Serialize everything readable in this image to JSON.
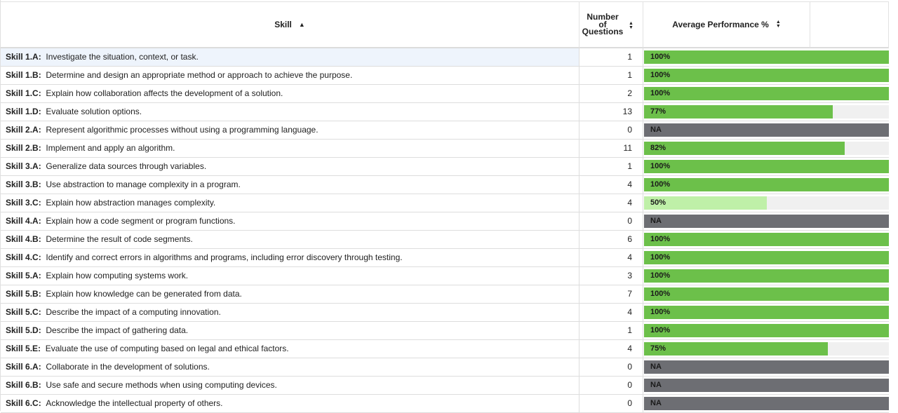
{
  "header": {
    "skill_label": "Skill",
    "skill_sort_icon": "sort-asc-icon",
    "num_label_line1": "Number",
    "num_label_line2": "of",
    "num_label_line3": "Questions",
    "num_sort_icon": "sort-both-icon",
    "perf_label": "Average Performance %",
    "perf_sort_icon": "sort-both-icon"
  },
  "colors": {
    "full": "#6cc04a",
    "partial_light": "#bff0a8",
    "na": "#6d6e73",
    "track": "#f0f0f0"
  },
  "rows": [
    {
      "code": "Skill 1.A:",
      "desc": "Investigate the situation, context, or task.",
      "count": "1",
      "perf_label": "100%",
      "perf": 100,
      "kind": "full"
    },
    {
      "code": "Skill 1.B:",
      "desc": "Determine and design an appropriate method or approach to achieve the purpose.",
      "count": "1",
      "perf_label": "100%",
      "perf": 100,
      "kind": "full"
    },
    {
      "code": "Skill 1.C:",
      "desc": "Explain how collaboration affects the development of a solution.",
      "count": "2",
      "perf_label": "100%",
      "perf": 100,
      "kind": "full"
    },
    {
      "code": "Skill 1.D:",
      "desc": "Evaluate solution options.",
      "count": "13",
      "perf_label": "77%",
      "perf": 77,
      "kind": "full"
    },
    {
      "code": "Skill 2.A:",
      "desc": "Represent algorithmic processes without using a programming language.",
      "count": "0",
      "perf_label": "NA",
      "perf": 100,
      "kind": "na"
    },
    {
      "code": "Skill 2.B:",
      "desc": "Implement and apply an algorithm.",
      "count": "11",
      "perf_label": "82%",
      "perf": 82,
      "kind": "full"
    },
    {
      "code": "Skill 3.A:",
      "desc": "Generalize data sources through variables.",
      "count": "1",
      "perf_label": "100%",
      "perf": 100,
      "kind": "full"
    },
    {
      "code": "Skill 3.B:",
      "desc": "Use abstraction to manage complexity in a program.",
      "count": "4",
      "perf_label": "100%",
      "perf": 100,
      "kind": "full"
    },
    {
      "code": "Skill 3.C:",
      "desc": "Explain how abstraction manages complexity.",
      "count": "4",
      "perf_label": "50%",
      "perf": 50,
      "kind": "light"
    },
    {
      "code": "Skill 4.A:",
      "desc": "Explain how a code segment or program functions.",
      "count": "0",
      "perf_label": "NA",
      "perf": 100,
      "kind": "na"
    },
    {
      "code": "Skill 4.B:",
      "desc": "Determine the result of code segments.",
      "count": "6",
      "perf_label": "100%",
      "perf": 100,
      "kind": "full"
    },
    {
      "code": "Skill 4.C:",
      "desc": "Identify and correct errors in algorithms and programs, including error discovery through testing.",
      "count": "4",
      "perf_label": "100%",
      "perf": 100,
      "kind": "full"
    },
    {
      "code": "Skill 5.A:",
      "desc": "Explain how computing systems work.",
      "count": "3",
      "perf_label": "100%",
      "perf": 100,
      "kind": "full"
    },
    {
      "code": "Skill 5.B:",
      "desc": "Explain how knowledge can be generated from data.",
      "count": "7",
      "perf_label": "100%",
      "perf": 100,
      "kind": "full"
    },
    {
      "code": "Skill 5.C:",
      "desc": "Describe the impact of a computing innovation.",
      "count": "4",
      "perf_label": "100%",
      "perf": 100,
      "kind": "full"
    },
    {
      "code": "Skill 5.D:",
      "desc": "Describe the impact of gathering data.",
      "count": "1",
      "perf_label": "100%",
      "perf": 100,
      "kind": "full"
    },
    {
      "code": "Skill 5.E:",
      "desc": "Evaluate the use of computing based on legal and ethical factors.",
      "count": "4",
      "perf_label": "75%",
      "perf": 75,
      "kind": "full"
    },
    {
      "code": "Skill 6.A:",
      "desc": "Collaborate in the development of solutions.",
      "count": "0",
      "perf_label": "NA",
      "perf": 100,
      "kind": "na"
    },
    {
      "code": "Skill 6.B:",
      "desc": "Use safe and secure methods when using computing devices.",
      "count": "0",
      "perf_label": "NA",
      "perf": 100,
      "kind": "na"
    },
    {
      "code": "Skill 6.C:",
      "desc": "Acknowledge the intellectual property of others.",
      "count": "0",
      "perf_label": "NA",
      "perf": 100,
      "kind": "na"
    }
  ]
}
